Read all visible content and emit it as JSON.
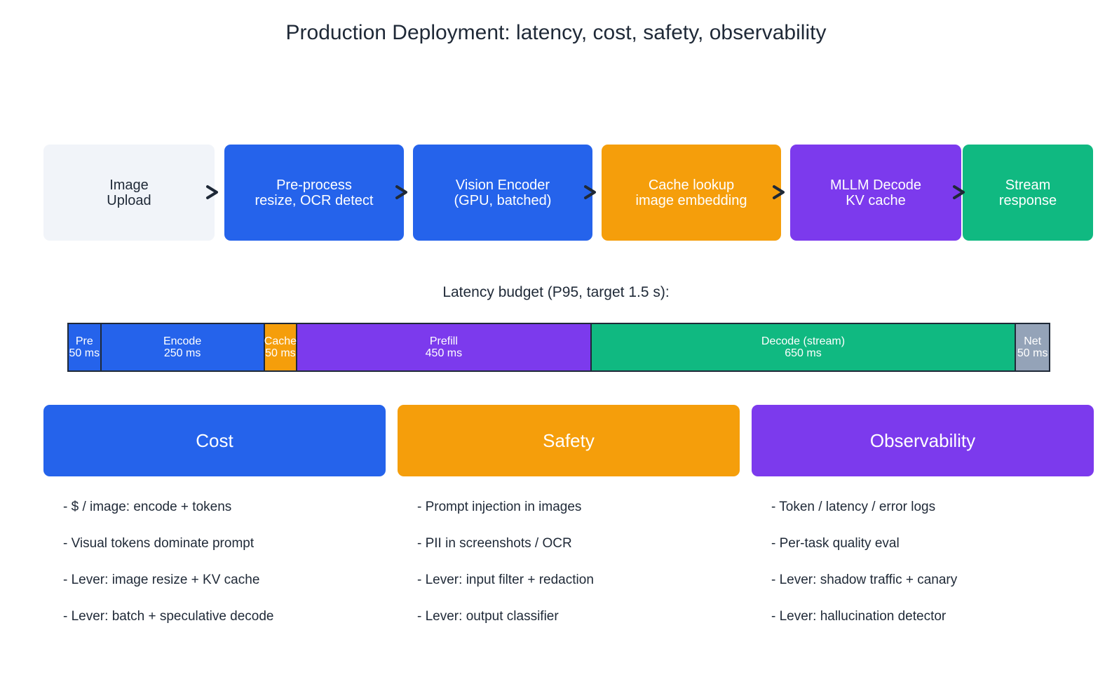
{
  "title": "Production Deployment: latency, cost, safety, observability",
  "pipeline": [
    {
      "lines": [
        "Image",
        "Upload"
      ],
      "bg": "#f1f4f9",
      "fg": "#1f2937"
    },
    {
      "lines": [
        "Pre-process",
        "resize, OCR detect"
      ],
      "bg": "#2563eb",
      "fg": "#ffffff"
    },
    {
      "lines": [
        "Vision Encoder",
        "(GPU, batched)"
      ],
      "bg": "#2563eb",
      "fg": "#ffffff"
    },
    {
      "lines": [
        "Cache lookup",
        "image embedding"
      ],
      "bg": "#f59e0b",
      "fg": "#ffffff"
    },
    {
      "lines": [
        "MLLM Decode",
        "KV cache"
      ],
      "bg": "#7c3aed",
      "fg": "#ffffff"
    },
    {
      "lines": [
        "Stream",
        "response"
      ],
      "bg": "#10b981",
      "fg": "#ffffff"
    }
  ],
  "arrow_icon": "chevron-right-arrow",
  "budget": {
    "title": "Latency budget (P95, target 1.5 s):",
    "segments": [
      {
        "name": "Pre",
        "label": "50 ms",
        "ms": 50,
        "color": "#2563eb"
      },
      {
        "name": "Encode",
        "label": "250 ms",
        "ms": 250,
        "color": "#2563eb"
      },
      {
        "name": "Cache",
        "label": "50 ms",
        "ms": 50,
        "color": "#f59e0b"
      },
      {
        "name": "Prefill",
        "label": "450 ms",
        "ms": 450,
        "color": "#7c3aed"
      },
      {
        "name": "Decode (stream)",
        "label": "650 ms",
        "ms": 650,
        "color": "#10b981"
      },
      {
        "name": "Net",
        "label": "50 ms",
        "ms": 50,
        "color": "#94a3b8"
      }
    ]
  },
  "pillars": [
    {
      "title": "Cost",
      "color": "#2563eb",
      "items": [
        "- $ / image: encode + tokens",
        "- Visual tokens dominate prompt",
        "- Lever: image resize + KV cache",
        "- Lever: batch + speculative decode"
      ]
    },
    {
      "title": "Safety",
      "color": "#f59e0b",
      "items": [
        "- Prompt injection in images",
        "- PII in screenshots / OCR",
        "- Lever: input filter + redaction",
        "- Lever: output classifier"
      ]
    },
    {
      "title": "Observability",
      "color": "#7c3aed",
      "items": [
        "- Token / latency / error logs",
        "- Per-task quality eval",
        "- Lever: shadow traffic + canary",
        "- Lever: hallucination detector"
      ]
    }
  ]
}
